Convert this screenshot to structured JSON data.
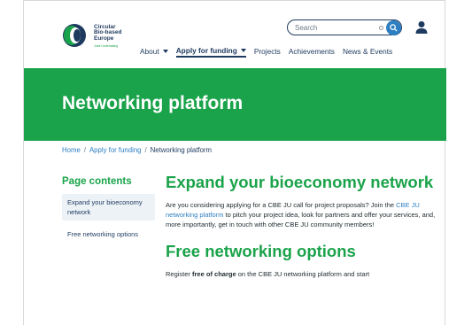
{
  "brand": {
    "name_lines": [
      "Circular",
      "Bio-based",
      "Europe"
    ],
    "subline": "Joint Undertaking",
    "colors": {
      "green": "#1aa34a",
      "navy": "#1e3a5f",
      "blue": "#2d7fc1"
    }
  },
  "search": {
    "placeholder": "Search",
    "button_icon": "search-icon"
  },
  "user_icon": "user-icon",
  "nav": {
    "items": [
      {
        "label": "About",
        "has_caret": true
      },
      {
        "label": "Apply for funding",
        "has_caret": true,
        "active": true
      },
      {
        "label": "Projects"
      },
      {
        "label": "Achievements"
      },
      {
        "label": "News & Events"
      }
    ]
  },
  "hero": {
    "title": "Networking platform"
  },
  "breadcrumb": {
    "home": "Home",
    "sep": "/",
    "level2": "Apply for funding",
    "current": "Networking platform"
  },
  "sidebar": {
    "title": "Page contents",
    "items": [
      {
        "label": "Expand your bioeconomy network",
        "active": true
      },
      {
        "label": "Free networking options",
        "active": false
      }
    ]
  },
  "main": {
    "section1": {
      "heading": "Expand your bioeconomy network",
      "p_before": "Are you considering applying for a CBE JU call for project proposals? Join the ",
      "p_link": "CBE JU networking platform",
      "p_after": " to pitch your project idea, look for partners and offer your services, and, more importantly, get in touch with other CBE JU community members!"
    },
    "section2": {
      "heading": "Free networking options",
      "p_before": "Register ",
      "p_bold": "free of charge",
      "p_middle": " on the ",
      "p_link": "CBE JU networking platform",
      "p_after": " and start"
    }
  }
}
